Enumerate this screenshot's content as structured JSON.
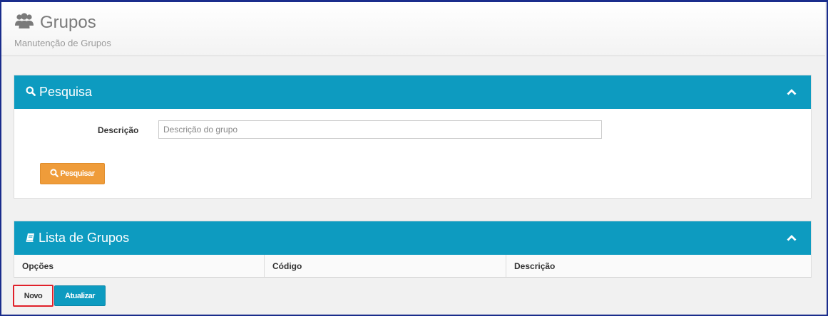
{
  "header": {
    "title": "Grupos",
    "subtitle": "Manutenção de Grupos",
    "icon": "users-icon"
  },
  "search_panel": {
    "title": "Pesquisa",
    "icon": "search-icon",
    "collapse_icon": "chevron-up-icon",
    "description_label": "Descrição",
    "description_value": "",
    "description_placeholder": "Descrição do grupo",
    "search_button_label": "Pesquisar"
  },
  "list_panel": {
    "title": "Lista de Grupos",
    "icon": "book-icon",
    "collapse_icon": "chevron-up-icon",
    "columns": [
      "Opções",
      "Código",
      "Descrição"
    ],
    "rows": []
  },
  "actions": {
    "new_label": "Novo",
    "refresh_label": "Atualizar"
  },
  "colors": {
    "panel_header": "#0d9bc0",
    "search_button": "#ef9c3a",
    "refresh_button": "#0d9bc0",
    "highlight_border": "#e0202a"
  }
}
